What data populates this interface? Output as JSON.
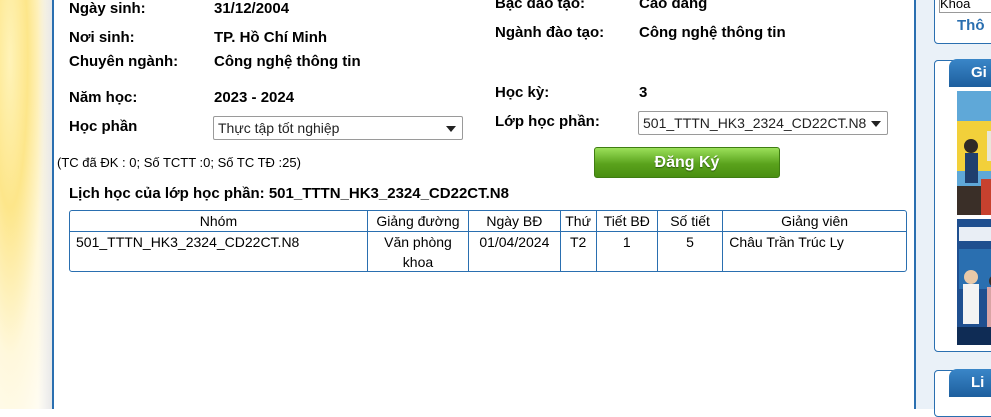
{
  "student": {
    "dob_label": "Ngày sinh:",
    "dob_value": "31/12/2004",
    "birthplace_label": "Nơi sinh:",
    "birthplace_value": "TP. Hồ Chí Minh",
    "major_label": "Chuyên ngành:",
    "major_value": "Công nghệ thông tin",
    "level_label": "Bậc đào tạo:",
    "level_value": "Cao đẳng",
    "field_label": "Ngành đào tạo:",
    "field_value": "Công nghệ thông tin"
  },
  "registration": {
    "year_label": "Năm học:",
    "year_value": "2023 - 2024",
    "semester_label": "Học kỳ:",
    "semester_value": "3",
    "module_label": "Học phần",
    "module_selected": "Thực tập tốt nghiệp",
    "class_label": "Lớp học phần:",
    "class_selected": "501_TTTN_HK3_2324_CD22CT.N8",
    "credits_text": "(TC đã ĐK : 0;  Số TCTT :0;  Số TC TĐ :25)",
    "register_button": "Đăng Ký"
  },
  "schedule": {
    "title": "Lịch học của lớp học phần: 501_TTTN_HK3_2324_CD22CT.N8",
    "headers": [
      "Nhóm",
      "Giảng đường",
      "Ngày BĐ",
      "Thứ",
      "Tiết BĐ",
      "Số tiết",
      "Giảng viên"
    ],
    "rows": [
      [
        "501_TTTN_HK3_2324_CD22CT.N8",
        "Văn phòng khoa",
        "01/04/2024",
        "T2",
        "1",
        "5",
        "Châu Trần Trúc Ly"
      ]
    ]
  },
  "sidebar": {
    "select_text": "Khoa",
    "box1_text": "Thô",
    "box2_header": "Gi",
    "box3_header": "Li"
  }
}
